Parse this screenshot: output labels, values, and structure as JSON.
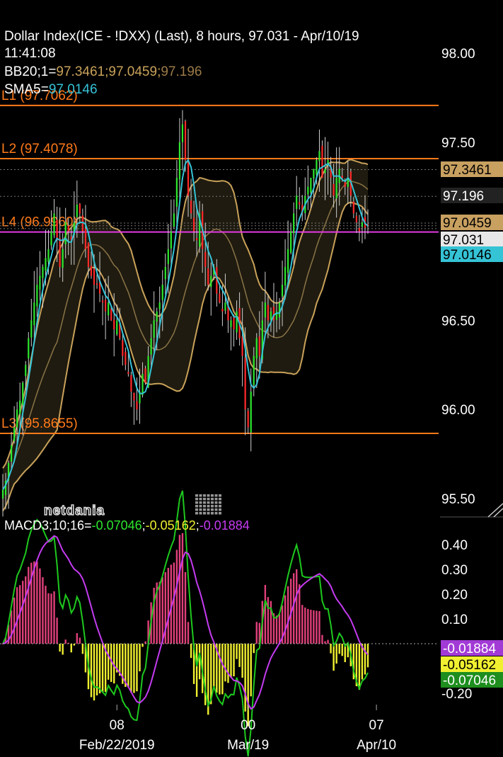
{
  "header": {
    "title": "Dollar Index(ICE - !DXX) (Last),  8 hours, 97.031 - Apr/10/19",
    "time": "11:41:08",
    "bb_label": "BB20;1=",
    "bb_upper": "97.3461",
    "bb_mid": "97.0459",
    "bb_lower": "97.196",
    "sma_label": "SMA5=",
    "sma_value": "97.0146",
    "macd_label": "MACD3;10;16=",
    "macd_v1": "-0.07046",
    "macd_v2": "-0.05162",
    "macd_v3": "-0.01884"
  },
  "watermark": "netdania",
  "colors": {
    "background": "#000000",
    "up_candle": "#2ee62e",
    "down_candle": "#ff2a2a",
    "wick": "#cfcfcf",
    "bollinger": "#c9a25a",
    "sma": "#35c3d6",
    "level_line": "#ff7a1a",
    "level_l4": "#e33be3",
    "macd_line": "#1ec81e",
    "signal_line": "#c43bf0",
    "hist_pos": "#e0407a",
    "hist_neg": "#f0f030"
  },
  "chart_data": {
    "type": "candlestick",
    "price_axis": {
      "ticks": [
        "98.00",
        "97.50",
        "96.50",
        "96.00",
        "95.50"
      ],
      "tick_values": [
        98.0,
        97.5,
        96.5,
        96.0,
        95.5
      ]
    },
    "price_tags": [
      {
        "label": "97.3461",
        "value": 97.3461,
        "bg": "#c8a060",
        "fg": "#000"
      },
      {
        "label": "97.196",
        "value": 97.196,
        "bg": "#222",
        "fg": "#fff"
      },
      {
        "label": "97.0459",
        "value": 97.0459,
        "bg": "#c8a060",
        "fg": "#000"
      },
      {
        "label": "97.031",
        "value": 97.031,
        "bg": "#e8e8e8",
        "fg": "#000"
      },
      {
        "label": "97.0146",
        "value": 97.0146,
        "bg": "#35c3d6",
        "fg": "#000"
      }
    ],
    "levels": [
      {
        "label": "L1 (97.7062)",
        "value": 97.7062
      },
      {
        "label": "L2 (97.4078)",
        "value": 97.4078
      },
      {
        "label": "L4 (96.9960)",
        "value": 96.996
      },
      {
        "label": "L3 (95.8655)",
        "value": 95.8655
      }
    ],
    "x_ticks": [
      {
        "top": "08",
        "bottom": "Feb/22/2019",
        "index": 40
      },
      {
        "top": "00",
        "bottom": "Mar/19",
        "index": 86
      },
      {
        "top": "07",
        "bottom": "Apr/10",
        "index": 131
      }
    ],
    "closes": [
      95.55,
      95.6,
      95.7,
      95.8,
      95.9,
      96.0,
      96.05,
      96.15,
      96.25,
      96.4,
      96.5,
      96.6,
      96.7,
      96.75,
      96.8,
      96.85,
      96.9,
      97.0,
      97.1,
      96.95,
      96.8,
      96.9,
      97.05,
      97.0,
      96.95,
      97.05,
      97.15,
      97.1,
      97.0,
      96.9,
      96.8,
      96.75,
      96.7,
      96.7,
      96.65,
      96.6,
      96.55,
      96.6,
      96.5,
      96.45,
      96.5,
      96.4,
      96.3,
      96.25,
      96.2,
      96.1,
      96.05,
      96.0,
      96.1,
      96.2,
      96.15,
      96.3,
      96.4,
      96.5,
      96.55,
      96.6,
      96.7,
      96.8,
      96.9,
      97.0,
      97.1,
      97.3,
      97.5,
      97.6,
      97.4,
      97.2,
      97.1,
      97.0,
      96.95,
      97.1,
      96.9,
      96.8,
      96.7,
      96.75,
      96.8,
      96.65,
      96.6,
      96.55,
      96.6,
      96.5,
      96.5,
      96.45,
      96.55,
      96.4,
      96.3,
      96.0,
      95.9,
      96.1,
      96.3,
      96.4,
      96.3,
      96.5,
      96.6,
      96.5,
      96.55,
      96.5,
      96.55,
      96.6,
      96.7,
      96.8,
      96.9,
      97.0,
      97.1,
      97.2,
      97.15,
      97.1,
      97.2,
      97.25,
      97.3,
      97.35,
      97.4,
      97.45,
      97.3,
      97.35,
      97.4,
      97.3,
      97.2,
      97.3,
      97.35,
      97.3,
      97.25,
      97.3,
      97.2,
      97.1,
      97.05,
      97.0,
      97.05,
      97.02,
      97.031
    ],
    "macd_axis": {
      "ticks": [
        "0.40",
        "0.30",
        "0.20",
        "0.10",
        "-0.20"
      ],
      "tick_values": [
        0.4,
        0.3,
        0.2,
        0.1,
        -0.2
      ]
    },
    "macd_tags": [
      {
        "label": "-0.01884",
        "value": -0.01884,
        "bg": "#a23ad6",
        "fg": "#fff"
      },
      {
        "label": "-0.05162",
        "value": -0.05162,
        "bg": "#f0f030",
        "fg": "#000"
      },
      {
        "label": "-0.07046",
        "value": -0.07046,
        "bg": "#1e8e1e",
        "fg": "#fff"
      }
    ],
    "price_range": [
      95.4,
      98.15
    ],
    "macd_range": [
      -0.22,
      0.44
    ]
  }
}
